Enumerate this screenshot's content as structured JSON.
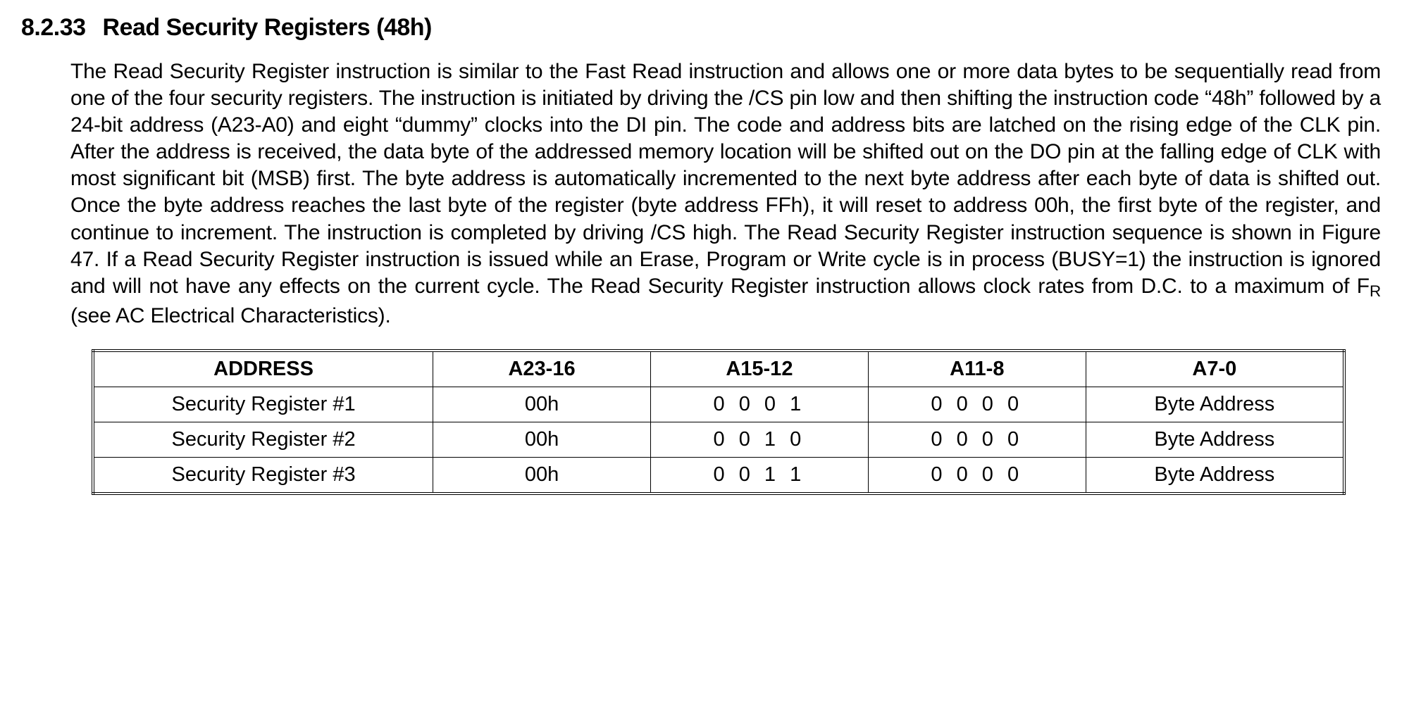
{
  "section": {
    "number": "8.2.33",
    "title": "Read Security Registers (48h)"
  },
  "paragraph": {
    "text_before_fr": "The Read Security Register instruction is similar to the Fast Read instruction and allows one or more data bytes to be sequentially read from one of the four security registers. The instruction is initiated by driving the /CS pin low and then shifting the instruction code “48h” followed by a 24-bit address (A23-A0) and eight “dummy” clocks into the DI pin. The code and address bits are latched on the rising edge of the CLK pin. After the address is received, the data byte of the addressed memory location will be shifted out on the DO pin at the falling edge of CLK with most significant bit (MSB) first. The byte address is automatically incremented to the next byte address after each byte of data is shifted out. Once the byte address reaches the last byte of the register (byte address FFh), it will reset to address 00h, the first byte of the register, and continue to increment. The instruction is completed by driving /CS high. The Read Security Register instruction sequence is shown in Figure 47. If a Read Security Register instruction is issued while an Erase, Program or Write cycle is in process (BUSY=1) the instruction is ignored and will not have any effects on the current cycle. The Read Security Register instruction allows clock rates from D.C. to a maximum of F",
    "fr_sub": "R",
    "text_after_fr": " (see AC Electrical Characteristics)."
  },
  "table": {
    "headers": {
      "address": "ADDRESS",
      "a23_16": "A23-16",
      "a15_12": "A15-12",
      "a11_8": "A11-8",
      "a7_0": "A7-0"
    },
    "rows": [
      {
        "address": "Security Register #1",
        "a23_16": "00h",
        "a15_12": "0 0 0 1",
        "a11_8": "0 0 0 0",
        "a7_0": "Byte Address"
      },
      {
        "address": "Security Register #2",
        "a23_16": "00h",
        "a15_12": "0 0 1 0",
        "a11_8": "0 0 0 0",
        "a7_0": "Byte Address"
      },
      {
        "address": "Security Register #3",
        "a23_16": "00h",
        "a15_12": "0 0 1 1",
        "a11_8": "0 0 0 0",
        "a7_0": "Byte Address"
      }
    ]
  }
}
